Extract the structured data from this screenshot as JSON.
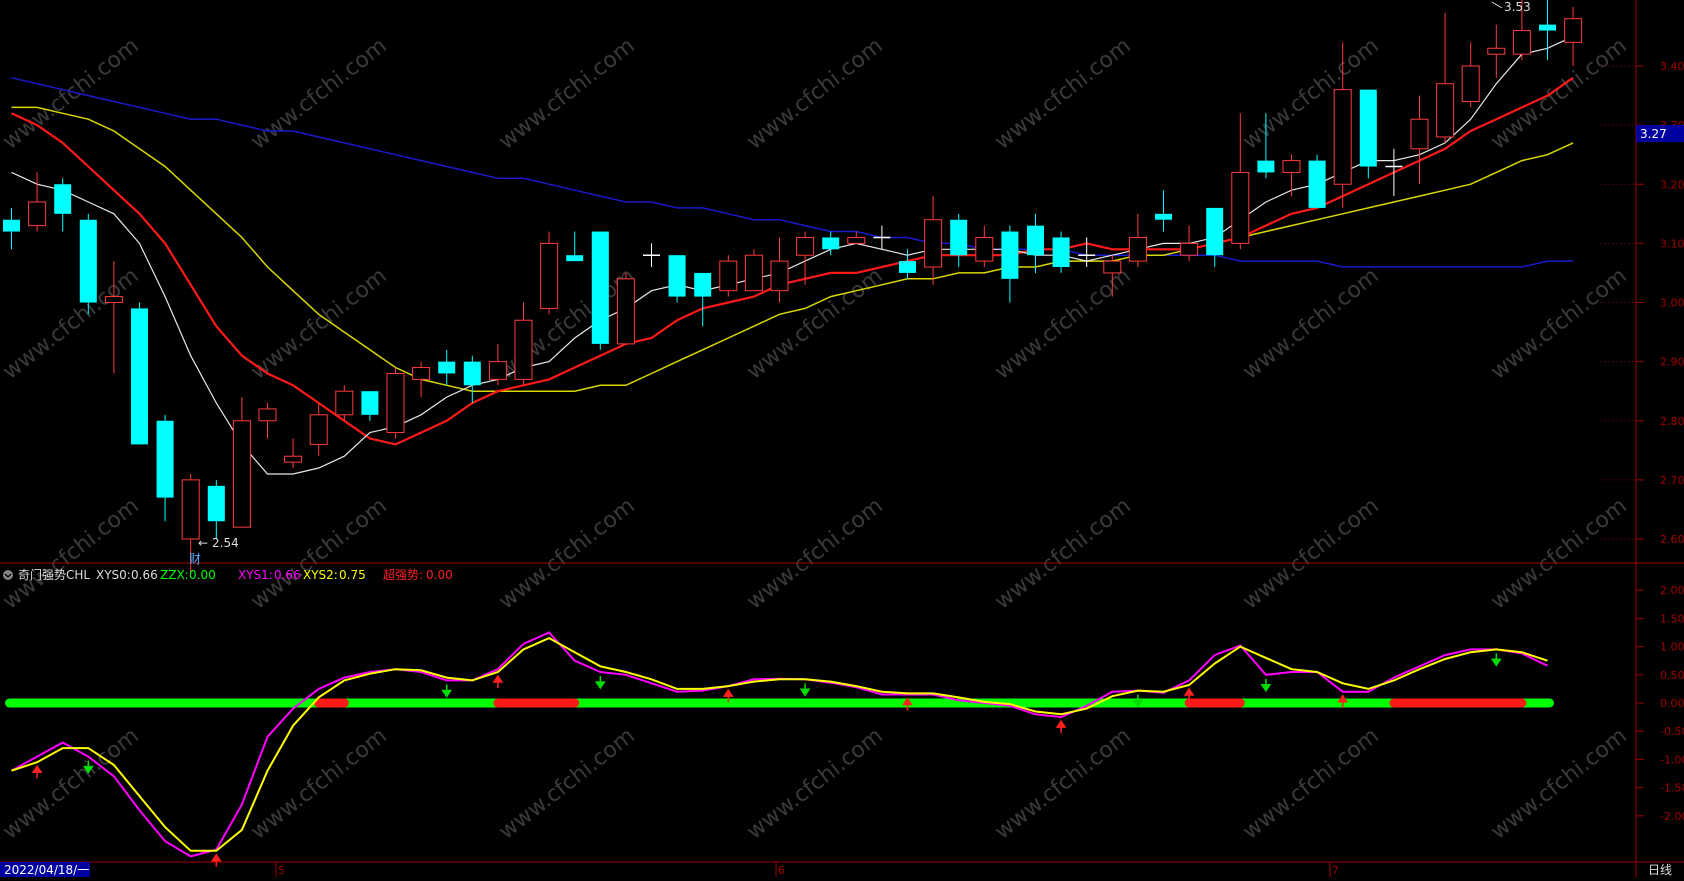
{
  "colors": {
    "up": "#ff3b3b",
    "down": "#00ffff",
    "doji": "#ffffff",
    "ma_white": "#e8e8e8",
    "ma_red": "#ff1a1a",
    "ma_yellow": "#d8d800",
    "ma_blue": "#1a1acc",
    "axis": "#a00000",
    "grid": "#6a0000",
    "xys1": "#ff00ff",
    "xys2": "#ffff00",
    "zzx_green": "#00ff00",
    "zzx_red": "#ff1a1a",
    "signal_up": "#ff2020",
    "signal_down": "#00dd00"
  },
  "price_axis": {
    "ticks": [
      "3.40",
      "3.30",
      "3.20",
      "3.10",
      "3.00",
      "2.90",
      "2.80",
      "2.70",
      "2.60"
    ],
    "current": "3.27",
    "high_label": "3.53",
    "low_label": "2.54",
    "low_event": "财"
  },
  "indicator": {
    "name": "奇门强势CHL",
    "xys0_label": "XYS0:",
    "xys0_value": "0.66",
    "zzx_label": "ZZX:",
    "zzx_value": "0.00",
    "xys1_label": "XYS1:",
    "xys1_value": "0.66",
    "xys2_label": "XYS2:",
    "xys2_value": "0.75",
    "super_label": "超强势:",
    "super_value": "0.00",
    "ticks": [
      "2.00",
      "1.50",
      "1.00",
      "0.50",
      "0.00",
      "-0.50",
      "-1.00",
      "-1.50",
      "-2.00"
    ]
  },
  "time_axis": {
    "start_date": "2022/04/18/一",
    "month_labels": [
      "5",
      "6",
      "7"
    ],
    "period": "日线"
  },
  "watermark": "www.cfchi.com",
  "chart_data": {
    "type": "candlestick",
    "ylim": [
      2.53,
      3.55
    ],
    "candles": [
      [
        3.14,
        3.12,
        3.16,
        3.09
      ],
      [
        3.13,
        3.17,
        3.22,
        3.12
      ],
      [
        3.2,
        3.15,
        3.21,
        3.12
      ],
      [
        3.14,
        3.0,
        3.15,
        2.98
      ],
      [
        3.0,
        3.01,
        3.07,
        2.88
      ],
      [
        2.99,
        2.76,
        3.0,
        2.76
      ],
      [
        2.8,
        2.67,
        2.81,
        2.63
      ],
      [
        2.6,
        2.7,
        2.71,
        2.54
      ],
      [
        2.69,
        2.63,
        2.7,
        2.6
      ],
      [
        2.62,
        2.8,
        2.84,
        2.62
      ],
      [
        2.8,
        2.82,
        2.83,
        2.77
      ],
      [
        2.73,
        2.74,
        2.77,
        2.72
      ],
      [
        2.76,
        2.81,
        2.83,
        2.74
      ],
      [
        2.81,
        2.85,
        2.86,
        2.8
      ],
      [
        2.85,
        2.81,
        2.85,
        2.8
      ],
      [
        2.78,
        2.88,
        2.89,
        2.77
      ],
      [
        2.87,
        2.89,
        2.9,
        2.84
      ],
      [
        2.9,
        2.88,
        2.92,
        2.86
      ],
      [
        2.9,
        2.86,
        2.91,
        2.83
      ],
      [
        2.87,
        2.9,
        2.93,
        2.86
      ],
      [
        2.87,
        2.97,
        3.0,
        2.86
      ],
      [
        2.99,
        3.1,
        3.12,
        2.98
      ],
      [
        3.08,
        3.07,
        3.12,
        3.07
      ],
      [
        3.12,
        2.93,
        3.12,
        2.92
      ],
      [
        2.93,
        3.04,
        3.05,
        2.93
      ],
      [
        3.08,
        3.08,
        3.1,
        3.06
      ],
      [
        3.08,
        3.01,
        3.08,
        3.0
      ],
      [
        3.05,
        3.01,
        3.05,
        2.96
      ],
      [
        3.02,
        3.07,
        3.08,
        3.01
      ],
      [
        3.02,
        3.08,
        3.09,
        3.02
      ],
      [
        3.02,
        3.07,
        3.11,
        3.0
      ],
      [
        3.08,
        3.11,
        3.12,
        3.03
      ],
      [
        3.11,
        3.09,
        3.12,
        3.08
      ],
      [
        3.1,
        3.11,
        3.12,
        3.1
      ],
      [
        3.11,
        3.11,
        3.13,
        3.09
      ],
      [
        3.07,
        3.05,
        3.09,
        3.04
      ],
      [
        3.06,
        3.14,
        3.18,
        3.03
      ],
      [
        3.14,
        3.08,
        3.15,
        3.06
      ],
      [
        3.07,
        3.11,
        3.13,
        3.06
      ],
      [
        3.12,
        3.04,
        3.13,
        3.0
      ],
      [
        3.13,
        3.08,
        3.15,
        3.05
      ],
      [
        3.11,
        3.06,
        3.12,
        3.05
      ],
      [
        3.08,
        3.08,
        3.11,
        3.06
      ],
      [
        3.05,
        3.07,
        3.08,
        3.01
      ],
      [
        3.07,
        3.11,
        3.15,
        3.06
      ],
      [
        3.15,
        3.14,
        3.19,
        3.12
      ],
      [
        3.08,
        3.1,
        3.13,
        3.07
      ],
      [
        3.16,
        3.08,
        3.16,
        3.06
      ],
      [
        3.1,
        3.22,
        3.32,
        3.09
      ],
      [
        3.24,
        3.22,
        3.32,
        3.21
      ],
      [
        3.22,
        3.24,
        3.25,
        3.18
      ],
      [
        3.24,
        3.16,
        3.25,
        3.16
      ],
      [
        3.2,
        3.36,
        3.44,
        3.16
      ],
      [
        3.36,
        3.23,
        3.36,
        3.21
      ],
      [
        3.23,
        3.23,
        3.26,
        3.18
      ],
      [
        3.26,
        3.31,
        3.35,
        3.2
      ],
      [
        3.28,
        3.37,
        3.49,
        3.27
      ],
      [
        3.34,
        3.4,
        3.44,
        3.33
      ],
      [
        3.42,
        3.43,
        3.47,
        3.38
      ],
      [
        3.42,
        3.46,
        3.52,
        3.41
      ],
      [
        3.47,
        3.46,
        3.53,
        3.41
      ],
      [
        3.44,
        3.48,
        3.5,
        3.4
      ]
    ],
    "ma_white": [
      3.22,
      3.2,
      3.19,
      3.17,
      3.15,
      3.1,
      3.01,
      2.91,
      2.83,
      2.76,
      2.71,
      2.71,
      2.72,
      2.74,
      2.78,
      2.79,
      2.81,
      2.84,
      2.86,
      2.87,
      2.89,
      2.9,
      2.94,
      2.97,
      2.99,
      3.02,
      3.03,
      3.02,
      3.03,
      3.04,
      3.05,
      3.07,
      3.09,
      3.1,
      3.09,
      3.08,
      3.09,
      3.09,
      3.09,
      3.09,
      3.08,
      3.08,
      3.07,
      3.08,
      3.09,
      3.1,
      3.1,
      3.11,
      3.14,
      3.17,
      3.19,
      3.2,
      3.22,
      3.24,
      3.24,
      3.25,
      3.27,
      3.31,
      3.37,
      3.42,
      3.43,
      3.45
    ],
    "ma_red": [
      3.32,
      3.3,
      3.27,
      3.23,
      3.19,
      3.15,
      3.1,
      3.03,
      2.96,
      2.91,
      2.88,
      2.86,
      2.83,
      2.8,
      2.77,
      2.76,
      2.78,
      2.8,
      2.83,
      2.85,
      2.86,
      2.87,
      2.89,
      2.91,
      2.93,
      2.94,
      2.97,
      2.99,
      3.0,
      3.01,
      3.03,
      3.04,
      3.05,
      3.05,
      3.06,
      3.07,
      3.08,
      3.08,
      3.08,
      3.08,
      3.09,
      3.09,
      3.1,
      3.09,
      3.09,
      3.09,
      3.09,
      3.1,
      3.11,
      3.13,
      3.15,
      3.16,
      3.18,
      3.2,
      3.22,
      3.24,
      3.26,
      3.29,
      3.31,
      3.33,
      3.35,
      3.38
    ],
    "ma_yellow": [
      3.33,
      3.33,
      3.32,
      3.31,
      3.29,
      3.26,
      3.23,
      3.19,
      3.15,
      3.11,
      3.06,
      3.02,
      2.98,
      2.95,
      2.92,
      2.89,
      2.87,
      2.86,
      2.85,
      2.85,
      2.85,
      2.85,
      2.85,
      2.86,
      2.86,
      2.88,
      2.9,
      2.92,
      2.94,
      2.96,
      2.98,
      2.99,
      3.01,
      3.02,
      3.03,
      3.04,
      3.04,
      3.05,
      3.05,
      3.06,
      3.06,
      3.07,
      3.07,
      3.07,
      3.08,
      3.08,
      3.09,
      3.1,
      3.11,
      3.12,
      3.13,
      3.14,
      3.15,
      3.16,
      3.17,
      3.18,
      3.19,
      3.2,
      3.22,
      3.24,
      3.25,
      3.27
    ],
    "ma_blue": [
      3.38,
      3.37,
      3.36,
      3.35,
      3.34,
      3.33,
      3.32,
      3.31,
      3.31,
      3.3,
      3.29,
      3.29,
      3.28,
      3.27,
      3.26,
      3.25,
      3.24,
      3.23,
      3.22,
      3.21,
      3.21,
      3.2,
      3.19,
      3.18,
      3.17,
      3.17,
      3.16,
      3.16,
      3.15,
      3.14,
      3.14,
      3.13,
      3.12,
      3.12,
      3.11,
      3.11,
      3.1,
      3.1,
      3.09,
      3.09,
      3.09,
      3.09,
      3.08,
      3.08,
      3.08,
      3.08,
      3.08,
      3.08,
      3.07,
      3.07,
      3.07,
      3.07,
      3.06,
      3.06,
      3.06,
      3.06,
      3.06,
      3.06,
      3.06,
      3.06,
      3.07,
      3.07
    ],
    "xys1": [
      -1.2,
      -0.95,
      -0.7,
      -0.95,
      -1.3,
      -1.9,
      -2.45,
      -2.72,
      -2.6,
      -1.8,
      -0.6,
      -0.1,
      0.25,
      0.45,
      0.55,
      0.6,
      0.55,
      0.4,
      0.4,
      0.6,
      1.05,
      1.25,
      0.75,
      0.55,
      0.5,
      0.35,
      0.2,
      0.22,
      0.3,
      0.42,
      0.43,
      0.42,
      0.36,
      0.28,
      0.15,
      0.15,
      0.15,
      0.05,
      0.0,
      -0.05,
      -0.2,
      -0.25,
      -0.05,
      0.2,
      0.22,
      0.18,
      0.4,
      0.85,
      1.02,
      0.5,
      0.55,
      0.55,
      0.2,
      0.2,
      0.45,
      0.65,
      0.85,
      0.95,
      0.95,
      0.88,
      0.66
    ],
    "xys2": [
      -1.2,
      -1.05,
      -0.8,
      -0.8,
      -1.1,
      -1.65,
      -2.2,
      -2.62,
      -2.62,
      -2.25,
      -1.2,
      -0.4,
      0.1,
      0.4,
      0.52,
      0.6,
      0.58,
      0.45,
      0.4,
      0.55,
      0.95,
      1.15,
      0.9,
      0.65,
      0.55,
      0.42,
      0.25,
      0.25,
      0.3,
      0.38,
      0.42,
      0.42,
      0.38,
      0.3,
      0.2,
      0.17,
      0.17,
      0.1,
      0.02,
      -0.02,
      -0.15,
      -0.2,
      -0.1,
      0.12,
      0.22,
      0.2,
      0.32,
      0.7,
      1.0,
      0.8,
      0.6,
      0.55,
      0.35,
      0.25,
      0.4,
      0.6,
      0.78,
      0.9,
      0.95,
      0.9,
      0.75
    ],
    "zzx_red_ranges": [
      [
        12,
        13
      ],
      [
        19,
        22
      ],
      [
        46,
        48
      ],
      [
        54,
        59
      ]
    ],
    "signals_up": [
      1,
      8,
      19,
      28,
      35,
      41,
      46,
      52
    ],
    "signals_down": [
      3,
      17,
      23,
      31,
      44,
      49,
      58
    ]
  }
}
